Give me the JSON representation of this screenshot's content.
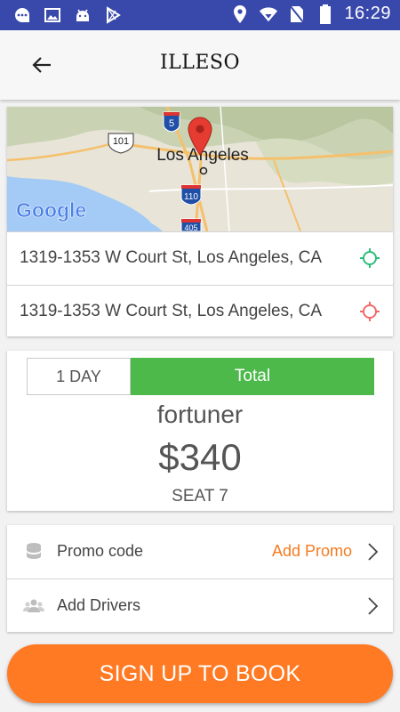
{
  "status_bar": {
    "time": "16:29",
    "left_icons": [
      "chat-icon",
      "image-icon",
      "android-icon",
      "play-store-icon"
    ],
    "right_icons": [
      "location-icon",
      "wifi-icon",
      "no-sim-icon",
      "battery-icon"
    ]
  },
  "app_bar": {
    "title": "ILLESO",
    "back_icon": "arrow-back-icon"
  },
  "map": {
    "city_label": "Los Angeles",
    "google_logo": "Google",
    "highway_shields": [
      "101",
      "5",
      "110",
      "405"
    ]
  },
  "locations": {
    "pickup": "1319-1353 W Court St, Los Angeles, CA",
    "dropoff": "1319-1353 W Court St, Los Angeles, CA",
    "pickup_icon": "gps-target-icon",
    "dropoff_icon": "gps-target-icon",
    "pickup_icon_color": "#2dbd7a",
    "dropoff_icon_color": "#f06a6a"
  },
  "booking": {
    "duration_tab": "1 DAY",
    "total_tab": "Total",
    "car_name": "fortuner",
    "price": "$340",
    "seats": "SEAT 7"
  },
  "options": {
    "promo_label": "Promo code",
    "promo_action": "Add Promo",
    "drivers_label": "Add Drivers"
  },
  "cta": {
    "label": "SIGN UP TO BOOK"
  },
  "colors": {
    "status_bar": "#3949ab",
    "accent_orange": "#ff7a23",
    "total_green": "#4cb94a",
    "promo_orange": "#f47b20"
  }
}
